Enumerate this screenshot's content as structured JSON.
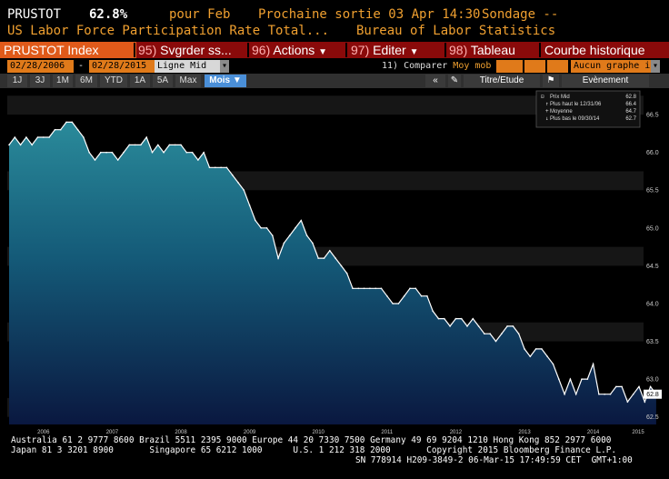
{
  "header": {
    "ticker": "PRUSTOT",
    "value": "62.8%",
    "period": "pour Feb",
    "next_release": "Prochaine sortie 03 Apr 14:30",
    "survey": "Sondage --",
    "name": "US Labor Force Participation Rate Total...",
    "source": "Bureau of Labor Statistics"
  },
  "menubar": {
    "index": "PRUSTOT Index",
    "save_num": "95)",
    "save_label": "Svgrder ss...",
    "actions_num": "96)",
    "actions_label": "Actions",
    "edit_num": "97)",
    "edit_label": "Editer",
    "table_num": "98)",
    "table_label": "Tableau",
    "title": "Courbe historique"
  },
  "controls": {
    "start_date": "02/28/2006",
    "dash": "-",
    "end_date": "02/28/2015",
    "line_type": "Ligne Mid",
    "compare_num": "11)",
    "compare_label": "Comparer",
    "compare_value": "Moy mob",
    "graph_type": "Aucun graphe inf"
  },
  "tabs": [
    "1J",
    "3J",
    "1M",
    "6M",
    "YTD",
    "1A",
    "5A",
    "Max"
  ],
  "period_selected": "Mois",
  "right_tabs": {
    "collapse": "«",
    "title_study": "Titre/Etude",
    "event": "Evènement"
  },
  "legend": {
    "items": [
      {
        "label": "Prix Mid",
        "value": "62.8"
      },
      {
        "label": "Plus haut le 12/31/06",
        "value": "66.4"
      },
      {
        "label": "Moyenne",
        "value": "64.7"
      },
      {
        "label": "Plus bas le 09/30/14",
        "value": "62.7"
      }
    ]
  },
  "chart_data": {
    "type": "area",
    "series": [
      {
        "name": "Prix Mid",
        "start": "2006-01",
        "frequency": "monthly",
        "values": [
          66.1,
          66.2,
          66.1,
          66.2,
          66.1,
          66.2,
          66.2,
          66.2,
          66.3,
          66.3,
          66.4,
          66.4,
          66.3,
          66.2,
          66.0,
          65.9,
          66.0,
          66.0,
          66.0,
          65.9,
          66.0,
          66.1,
          66.1,
          66.1,
          66.2,
          66.0,
          66.1,
          66.0,
          66.1,
          66.1,
          66.1,
          66.0,
          66.0,
          65.9,
          66.0,
          65.8,
          65.8,
          65.8,
          65.8,
          65.7,
          65.6,
          65.5,
          65.3,
          65.1,
          65.0,
          65.0,
          64.9,
          64.6,
          64.8,
          64.9,
          65.0,
          65.1,
          64.9,
          64.8,
          64.6,
          64.6,
          64.7,
          64.6,
          64.5,
          64.4,
          64.2,
          64.2,
          64.2,
          64.2,
          64.2,
          64.2,
          64.1,
          64.0,
          64.0,
          64.1,
          64.2,
          64.2,
          64.1,
          64.1,
          63.9,
          63.8,
          63.8,
          63.7,
          63.8,
          63.8,
          63.7,
          63.8,
          63.7,
          63.6,
          63.6,
          63.5,
          63.6,
          63.7,
          63.7,
          63.6,
          63.4,
          63.3,
          63.4,
          63.4,
          63.3,
          63.2,
          63.0,
          62.8,
          63.0,
          62.8,
          63.0,
          63.0,
          63.2,
          62.8,
          62.8,
          62.8,
          62.9,
          62.9,
          62.7,
          62.8,
          62.9,
          62.7,
          62.9,
          62.8
        ]
      }
    ],
    "x_ticks": [
      "2006",
      "2007",
      "2008",
      "2009",
      "2010",
      "2011",
      "2012",
      "2013",
      "2014",
      "2015"
    ],
    "y_ticks": [
      "66.5",
      "66.0",
      "65.5",
      "65.0",
      "64.5",
      "64.0",
      "63.5",
      "63.0",
      "62.5"
    ],
    "ylim": [
      62.4,
      66.85
    ],
    "last_value_label": "62.8"
  },
  "footer": {
    "line1": "Australia 61 2 9777 8600 Brazil 5511 2395 9000 Europe 44 20 7330 7500 Germany 49 69 9204 1210 Hong Kong 852 2977 6000",
    "line2": "Japan 81 3 3201 8900       Singapore 65 6212 1000      U.S. 1 212 318 2000       Copyright 2015 Bloomberg Finance L.P.",
    "line3": "SN 778914 H209-3849-2 06-Mar-15 17:49:59 CET  GMT+1:00"
  },
  "colors": {
    "accent": "#f0a030",
    "menubar": "#8a0a0a",
    "selected_tab": "#4a8fd8",
    "area_top": "#2a8a9a",
    "area_bottom": "#0a1840"
  }
}
